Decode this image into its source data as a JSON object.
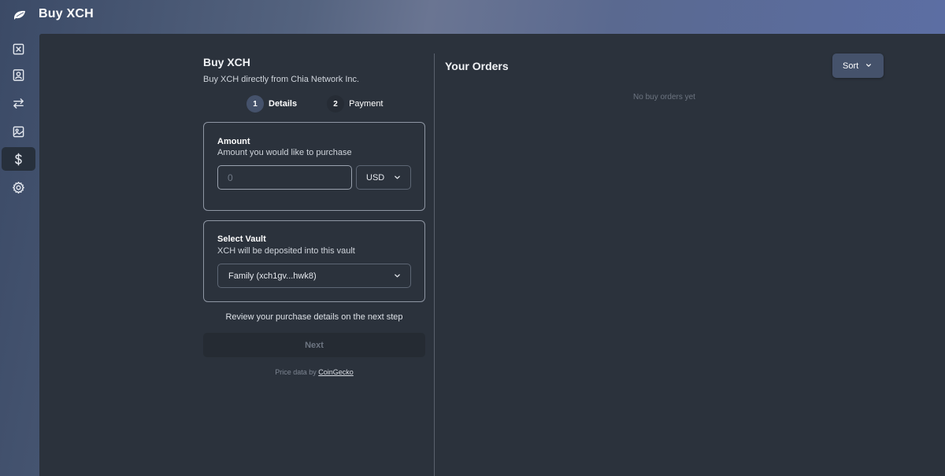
{
  "header": {
    "title": "Buy XCH",
    "logo_icon": "chia-leaf-icon"
  },
  "sidebar": {
    "items": [
      {
        "name": "wallet",
        "icon": "wallet-icon",
        "active": false
      },
      {
        "name": "contacts",
        "icon": "contact-card-icon",
        "active": false
      },
      {
        "name": "transactions",
        "icon": "swap-arrows-icon",
        "active": false
      },
      {
        "name": "nfts",
        "icon": "image-icon",
        "active": false
      },
      {
        "name": "buy",
        "icon": "dollar-icon",
        "active": true
      },
      {
        "name": "settings",
        "icon": "gear-icon",
        "active": false
      }
    ]
  },
  "buy": {
    "title": "Buy XCH",
    "subtitle": "Buy XCH directly from Chia Network Inc.",
    "steps": [
      {
        "number": "1",
        "label": "Details",
        "active": true
      },
      {
        "number": "2",
        "label": "Payment",
        "active": false
      }
    ],
    "amount": {
      "title": "Amount",
      "description": "Amount you would like to purchase",
      "placeholder": "0",
      "value": "",
      "currency": "USD"
    },
    "vault": {
      "title": "Select Vault",
      "description": "XCH will be deposited into this vault",
      "selected": "Family (xch1gv...hwk8)"
    },
    "review_note": "Review your purchase details on the next step",
    "next_label": "Next",
    "price_prefix": "Price data by",
    "price_link": "CoinGecko"
  },
  "orders": {
    "title": "Your Orders",
    "sort_label": "Sort",
    "empty_message": "No buy orders yet"
  },
  "colors": {
    "main_bg": "#2b323c",
    "accent": "#45526b",
    "border": "#8e96a3"
  }
}
